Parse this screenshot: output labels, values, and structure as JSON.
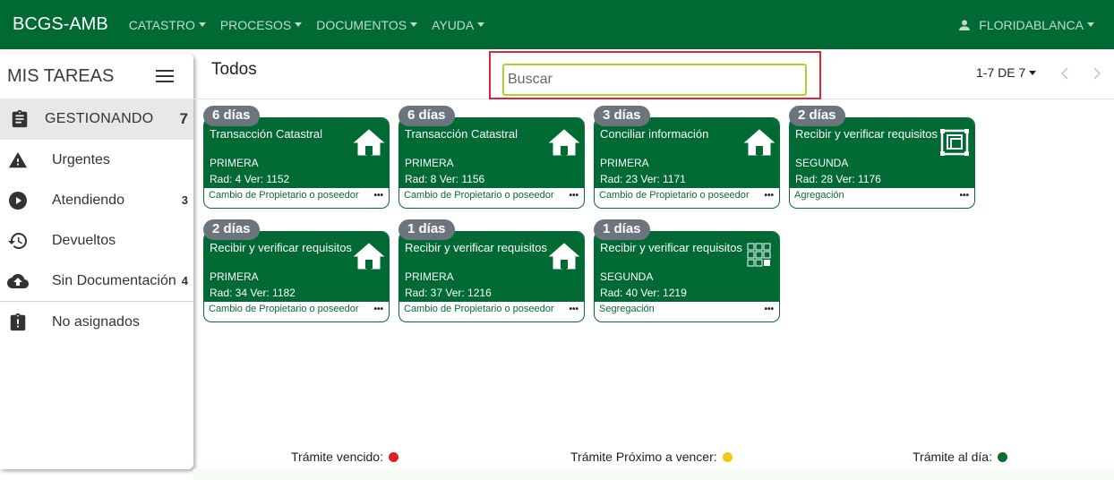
{
  "nav": {
    "brand": "BCGS-AMB",
    "menu": [
      "CATASTRO",
      "PROCESOS",
      "DOCUMENTOS",
      "AYUDA"
    ],
    "user": "FLORIDABLANCA",
    "color": "#006a34"
  },
  "sidebar": {
    "title": "MIS TAREAS",
    "active": {
      "label": "GESTIONANDO",
      "count": "7"
    },
    "items": [
      {
        "label": "Urgentes",
        "count": "",
        "icon": "warning-icon"
      },
      {
        "label": "Atendiendo",
        "count": "3",
        "icon": "play-icon"
      },
      {
        "label": "Devueltos",
        "count": "",
        "icon": "restore-icon"
      },
      {
        "label": "Sin Documentación",
        "count": "4",
        "icon": "cloud-upload-icon"
      },
      {
        "label": "No asignados",
        "count": "",
        "icon": "clipboard-alert-icon"
      }
    ]
  },
  "header": {
    "title": "Todos",
    "search_placeholder": "Buscar",
    "pager": "1-7 DE 7"
  },
  "cards": [
    {
      "days": "6 días",
      "name": "Transacción Catastral",
      "sub": "PRIMERA",
      "rad": "Rad: 4 Ver: 1152",
      "type": "Cambio de Propietario o poseedor",
      "icon": "home-icon"
    },
    {
      "days": "6 días",
      "name": "Transacción Catastral",
      "sub": "PRIMERA",
      "rad": "Rad: 8 Ver: 1156",
      "type": "Cambio de Propietario o poseedor",
      "icon": "home-icon"
    },
    {
      "days": "3 días",
      "name": "Conciliar información",
      "sub": "PRIMERA",
      "rad": "Rad: 23 Ver: 1171",
      "type": "Cambio de Propietario o poseedor",
      "icon": "home-icon"
    },
    {
      "days": "2 días",
      "name": "Recibir y verificar requisitos",
      "sub": "SEGUNDA",
      "rad": "Rad: 28 Ver: 1176",
      "type": "Agregación",
      "icon": "merge-icon"
    },
    {
      "days": "2 días",
      "name": "Recibir y verificar requisitos",
      "sub": "PRIMERA",
      "rad": "Rad: 34 Ver: 1182",
      "type": "Cambio de Propietario o poseedor",
      "icon": "home-icon"
    },
    {
      "days": "1 días",
      "name": "Recibir y verificar requisitos",
      "sub": "PRIMERA",
      "rad": "Rad: 37 Ver: 1216",
      "type": "Cambio de Propietario o poseedor",
      "icon": "home-icon"
    },
    {
      "days": "1 días",
      "name": "Recibir y verificar requisitos",
      "sub": "SEGUNDA",
      "rad": "Rad: 40 Ver: 1219",
      "type": "Segregación",
      "icon": "grid-split-icon"
    }
  ],
  "legend": [
    {
      "label": "Trámite vencido:",
      "color": "#e02020"
    },
    {
      "label": "Trámite Próximo a vencer:",
      "color": "#f5c518"
    },
    {
      "label": "Trámite al día:",
      "color": "#0a6b33"
    }
  ]
}
